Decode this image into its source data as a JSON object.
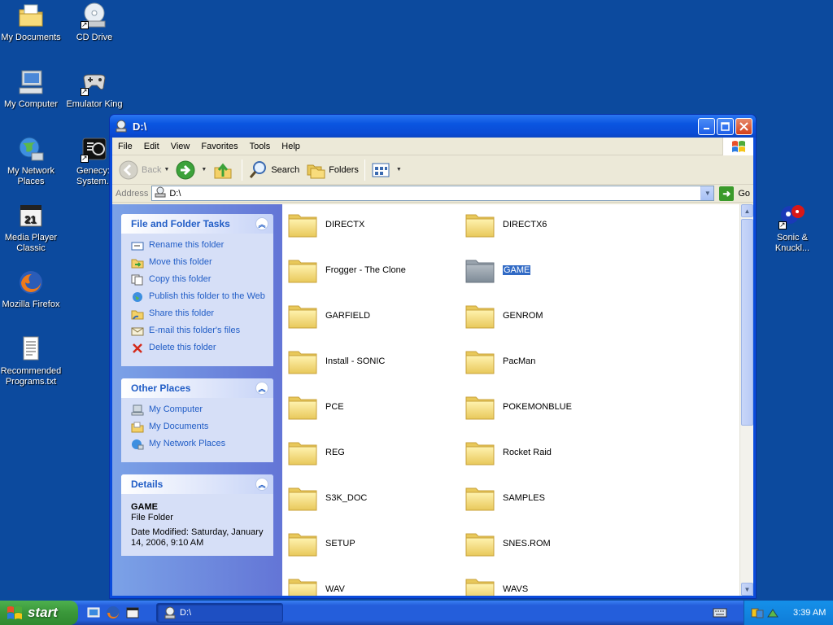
{
  "desktop": {
    "icons": [
      {
        "label": "My Documents"
      },
      {
        "label": "CD Drive"
      },
      {
        "label": "My Computer"
      },
      {
        "label": "Emulator King"
      },
      {
        "label": "My Network Places"
      },
      {
        "label": "Genecy: System.p"
      },
      {
        "label": "Media Player Classic"
      },
      {
        "label": "Mozilla Firefox"
      },
      {
        "label": "Recommended Programs.txt"
      },
      {
        "label": "Sonic & Knuckl..."
      }
    ]
  },
  "window": {
    "title": "D:\\",
    "menu": [
      "File",
      "Edit",
      "View",
      "Favorites",
      "Tools",
      "Help"
    ],
    "toolbar": {
      "back": "Back",
      "search": "Search",
      "folders": "Folders"
    },
    "address": {
      "label": "Address",
      "value": "D:\\",
      "go": "Go"
    },
    "tasks": {
      "file_folder": {
        "title": "File and Folder Tasks",
        "items": [
          "Rename this folder",
          "Move this folder",
          "Copy this folder",
          "Publish this folder to the Web",
          "Share this folder",
          "E-mail this folder's files",
          "Delete this folder"
        ]
      },
      "other_places": {
        "title": "Other Places",
        "items": [
          "My Computer",
          "My Documents",
          "My Network Places"
        ]
      },
      "details": {
        "title": "Details",
        "name": "GAME",
        "type": "File Folder",
        "modified": "Date Modified: Saturday, January 14, 2006, 9:10 AM"
      }
    },
    "files": [
      {
        "name": "DIRECTX"
      },
      {
        "name": "DIRECTX6"
      },
      {
        "name": "Frogger - The Clone"
      },
      {
        "name": "GAME",
        "selected": true
      },
      {
        "name": "GARFIELD"
      },
      {
        "name": "GENROM"
      },
      {
        "name": "Install - SONIC"
      },
      {
        "name": "PacMan"
      },
      {
        "name": "PCE"
      },
      {
        "name": "POKEMONBLUE"
      },
      {
        "name": "REG"
      },
      {
        "name": "Rocket Raid"
      },
      {
        "name": "S3K_DOC"
      },
      {
        "name": "SAMPLES"
      },
      {
        "name": "SETUP"
      },
      {
        "name": "SNES.ROM"
      },
      {
        "name": "WAV"
      },
      {
        "name": "WAVS"
      }
    ]
  },
  "taskbar": {
    "start": "start",
    "task": "D:\\",
    "clock": "3:39 AM"
  },
  "colors": {
    "desktop": "#0c4a9e",
    "titlebar": "#0a55e0",
    "link": "#215dc6",
    "selection": "#316ac5",
    "start": "#3a973a"
  }
}
